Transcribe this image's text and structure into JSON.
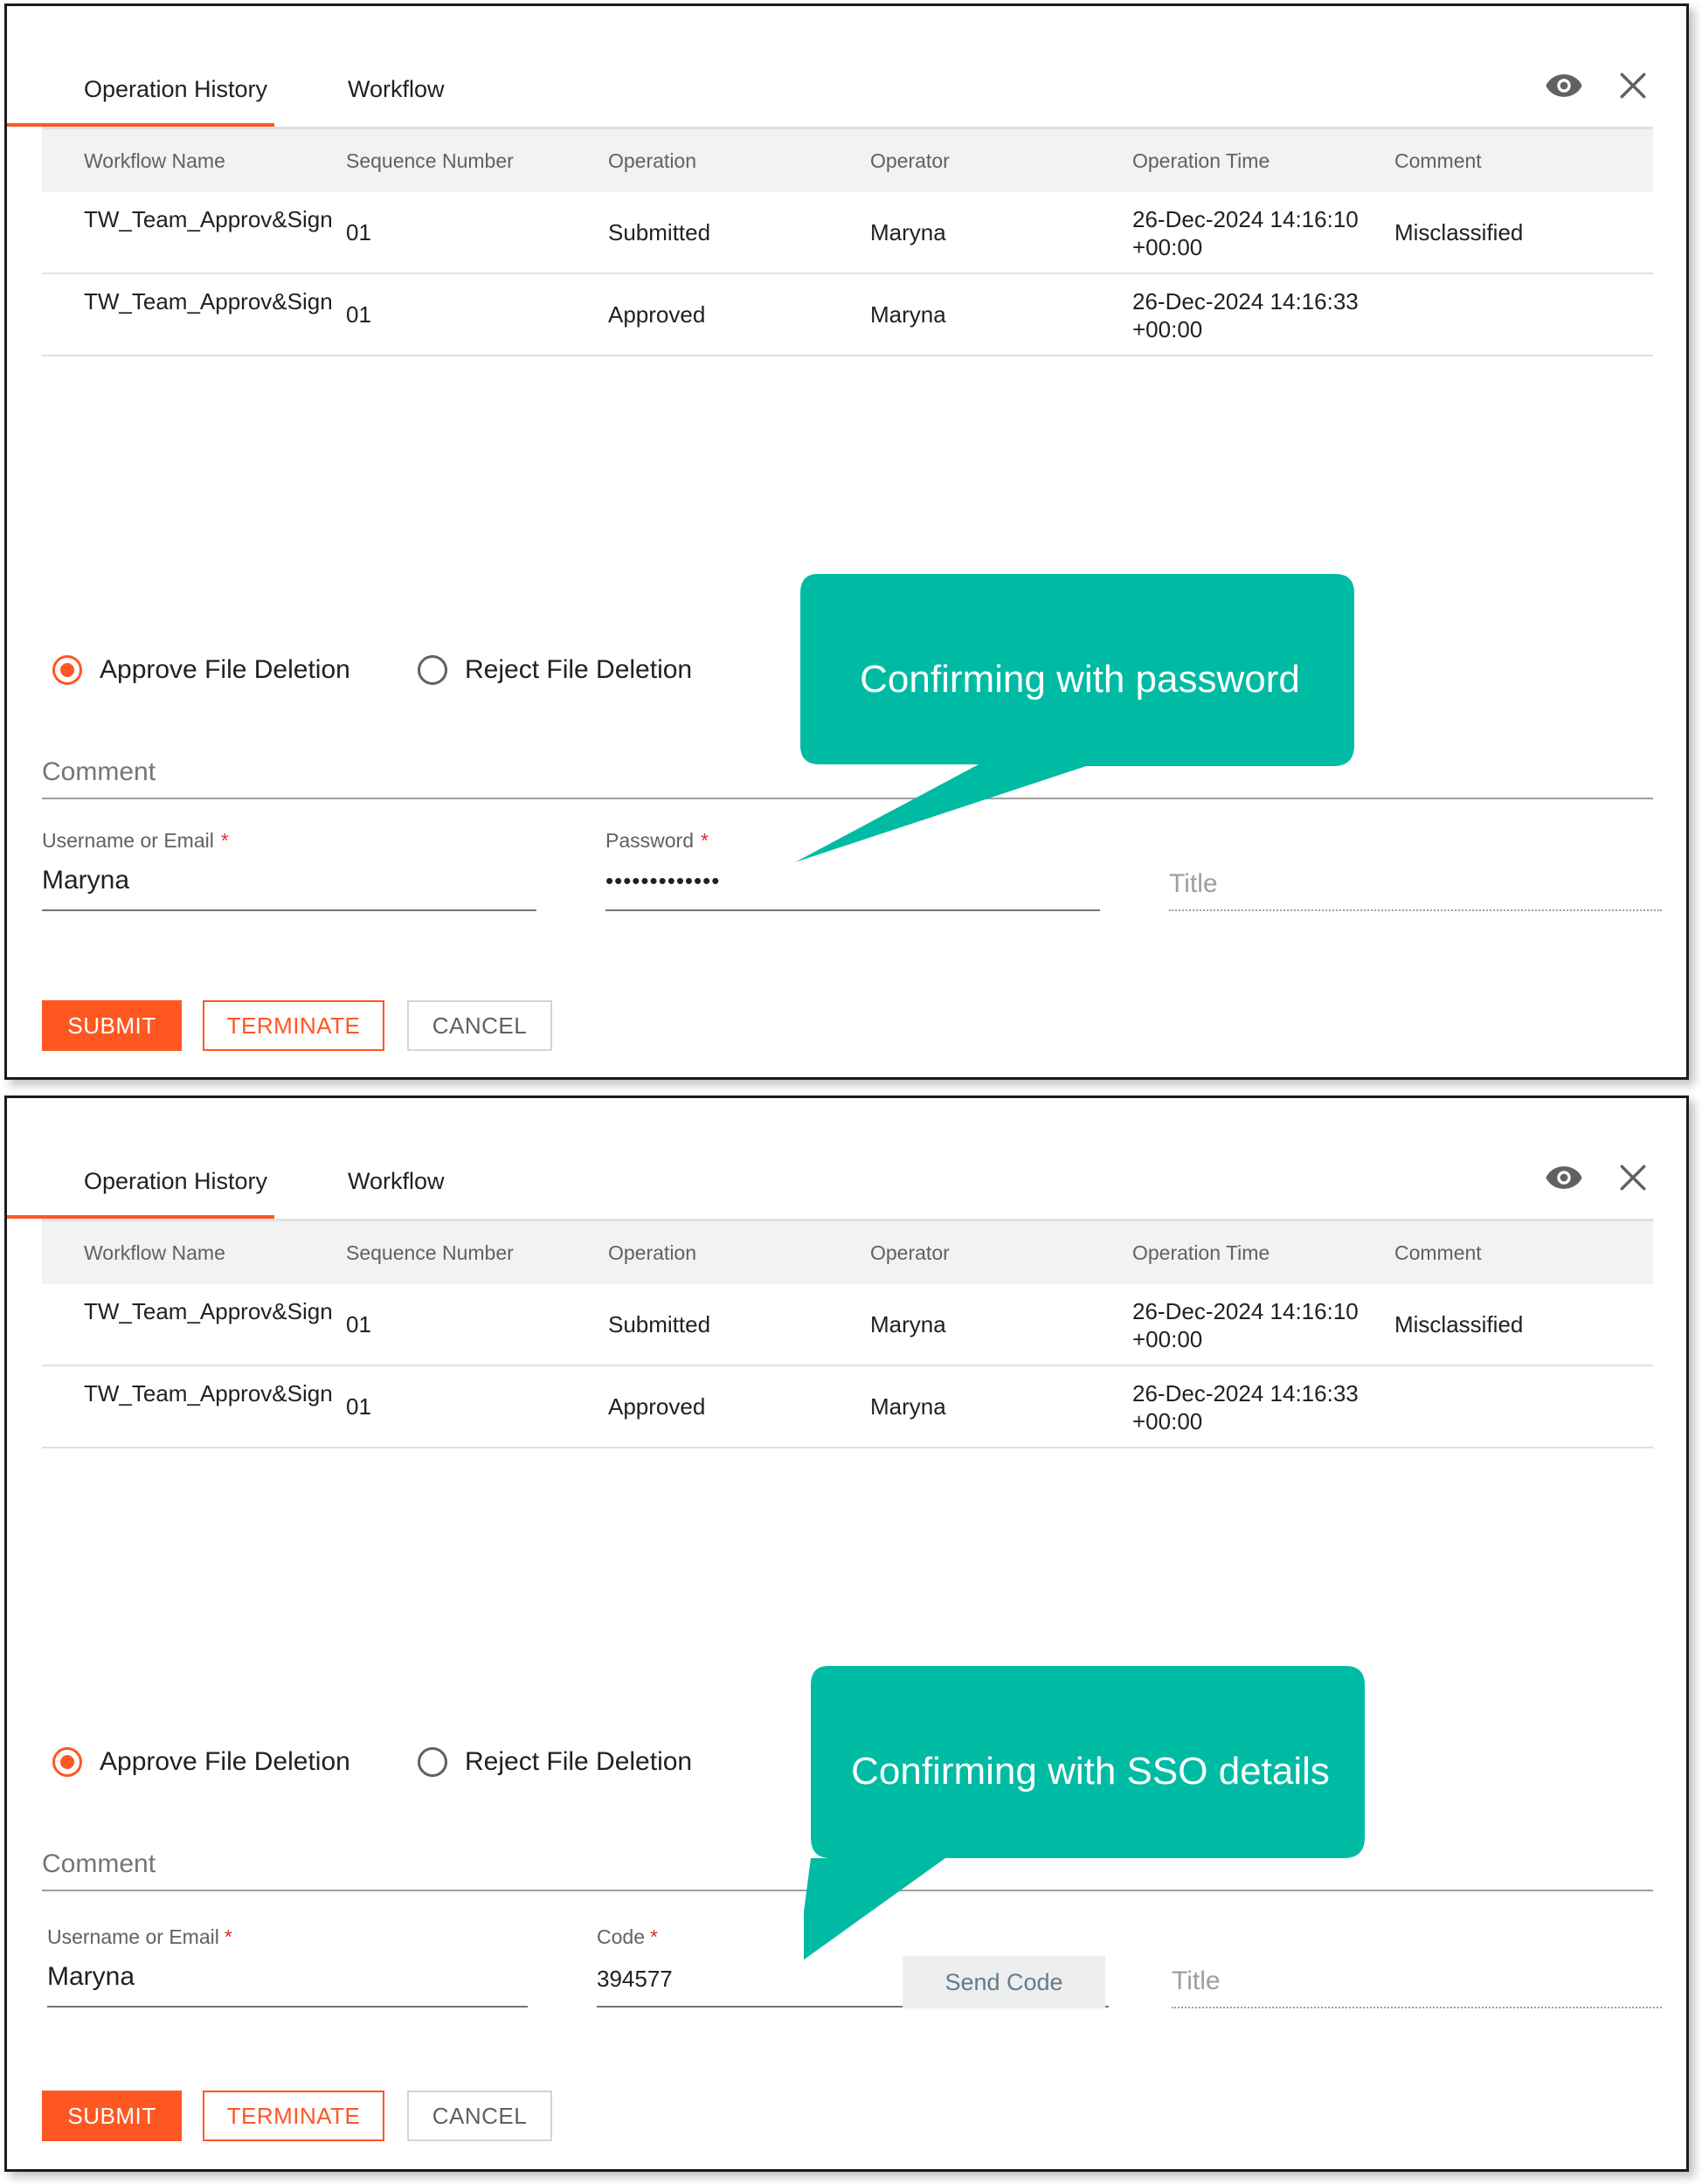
{
  "colors": {
    "accent": "#ff5722",
    "callout": "#00bba3",
    "header_bg": "#f2f2f2",
    "required": "#d32f2f"
  },
  "panels": [
    {
      "tabs": [
        {
          "label": "Operation History",
          "active": true
        },
        {
          "label": "Workflow",
          "active": false
        }
      ],
      "icons": [
        "eye-icon",
        "close-icon"
      ],
      "table": {
        "columns": [
          "Workflow Name",
          "Sequence Number",
          "Operation",
          "Operator",
          "Operation Time",
          "Comment"
        ],
        "rows": [
          {
            "workflow_name": "TW_Team_Approv&Sign",
            "sequence": "01",
            "operation": "Submitted",
            "operator": "Maryna",
            "time": "26-Dec-2024 14:16:10 +00:00",
            "comment": "Misclassified"
          },
          {
            "workflow_name": "TW_Team_Approv&Sign",
            "sequence": "01",
            "operation": "Approved",
            "operator": "Maryna",
            "time": "26-Dec-2024 14:16:33 +00:00",
            "comment": ""
          }
        ]
      },
      "radios": [
        {
          "label": "Approve File Deletion",
          "selected": true
        },
        {
          "label": "Reject File Deletion",
          "selected": false
        }
      ],
      "comment_placeholder": "Comment",
      "username": {
        "label": "Username or Email",
        "required_mark": "*",
        "value": "Maryna"
      },
      "password": {
        "label": "Password",
        "required_mark": "*",
        "value": "•••••••••••••"
      },
      "title_placeholder": "Title",
      "buttons": {
        "submit": "SUBMIT",
        "terminate": "TERMINATE",
        "cancel": "CANCEL"
      },
      "callout": "Confirming with password"
    },
    {
      "tabs": [
        {
          "label": "Operation History",
          "active": true
        },
        {
          "label": "Workflow",
          "active": false
        }
      ],
      "icons": [
        "eye-icon",
        "close-icon"
      ],
      "table": {
        "columns": [
          "Workflow Name",
          "Sequence Number",
          "Operation",
          "Operator",
          "Operation Time",
          "Comment"
        ],
        "rows": [
          {
            "workflow_name": "TW_Team_Approv&Sign",
            "sequence": "01",
            "operation": "Submitted",
            "operator": "Maryna",
            "time": "26-Dec-2024 14:16:10 +00:00",
            "comment": "Misclassified"
          },
          {
            "workflow_name": "TW_Team_Approv&Sign",
            "sequence": "01",
            "operation": "Approved",
            "operator": "Maryna",
            "time": "26-Dec-2024 14:16:33 +00:00",
            "comment": ""
          }
        ]
      },
      "radios": [
        {
          "label": "Approve File Deletion",
          "selected": true
        },
        {
          "label": "Reject File Deletion",
          "selected": false
        }
      ],
      "comment_placeholder": "Comment",
      "username": {
        "label": "Username or Email",
        "required_mark": "*",
        "value": "Maryna"
      },
      "code": {
        "label": "Code",
        "required_mark": "*",
        "value": "394577"
      },
      "send_code_label": "Send Code",
      "title_placeholder": "Title",
      "buttons": {
        "submit": "SUBMIT",
        "terminate": "TERMINATE",
        "cancel": "CANCEL"
      },
      "callout": "Confirming with SSO details"
    }
  ]
}
